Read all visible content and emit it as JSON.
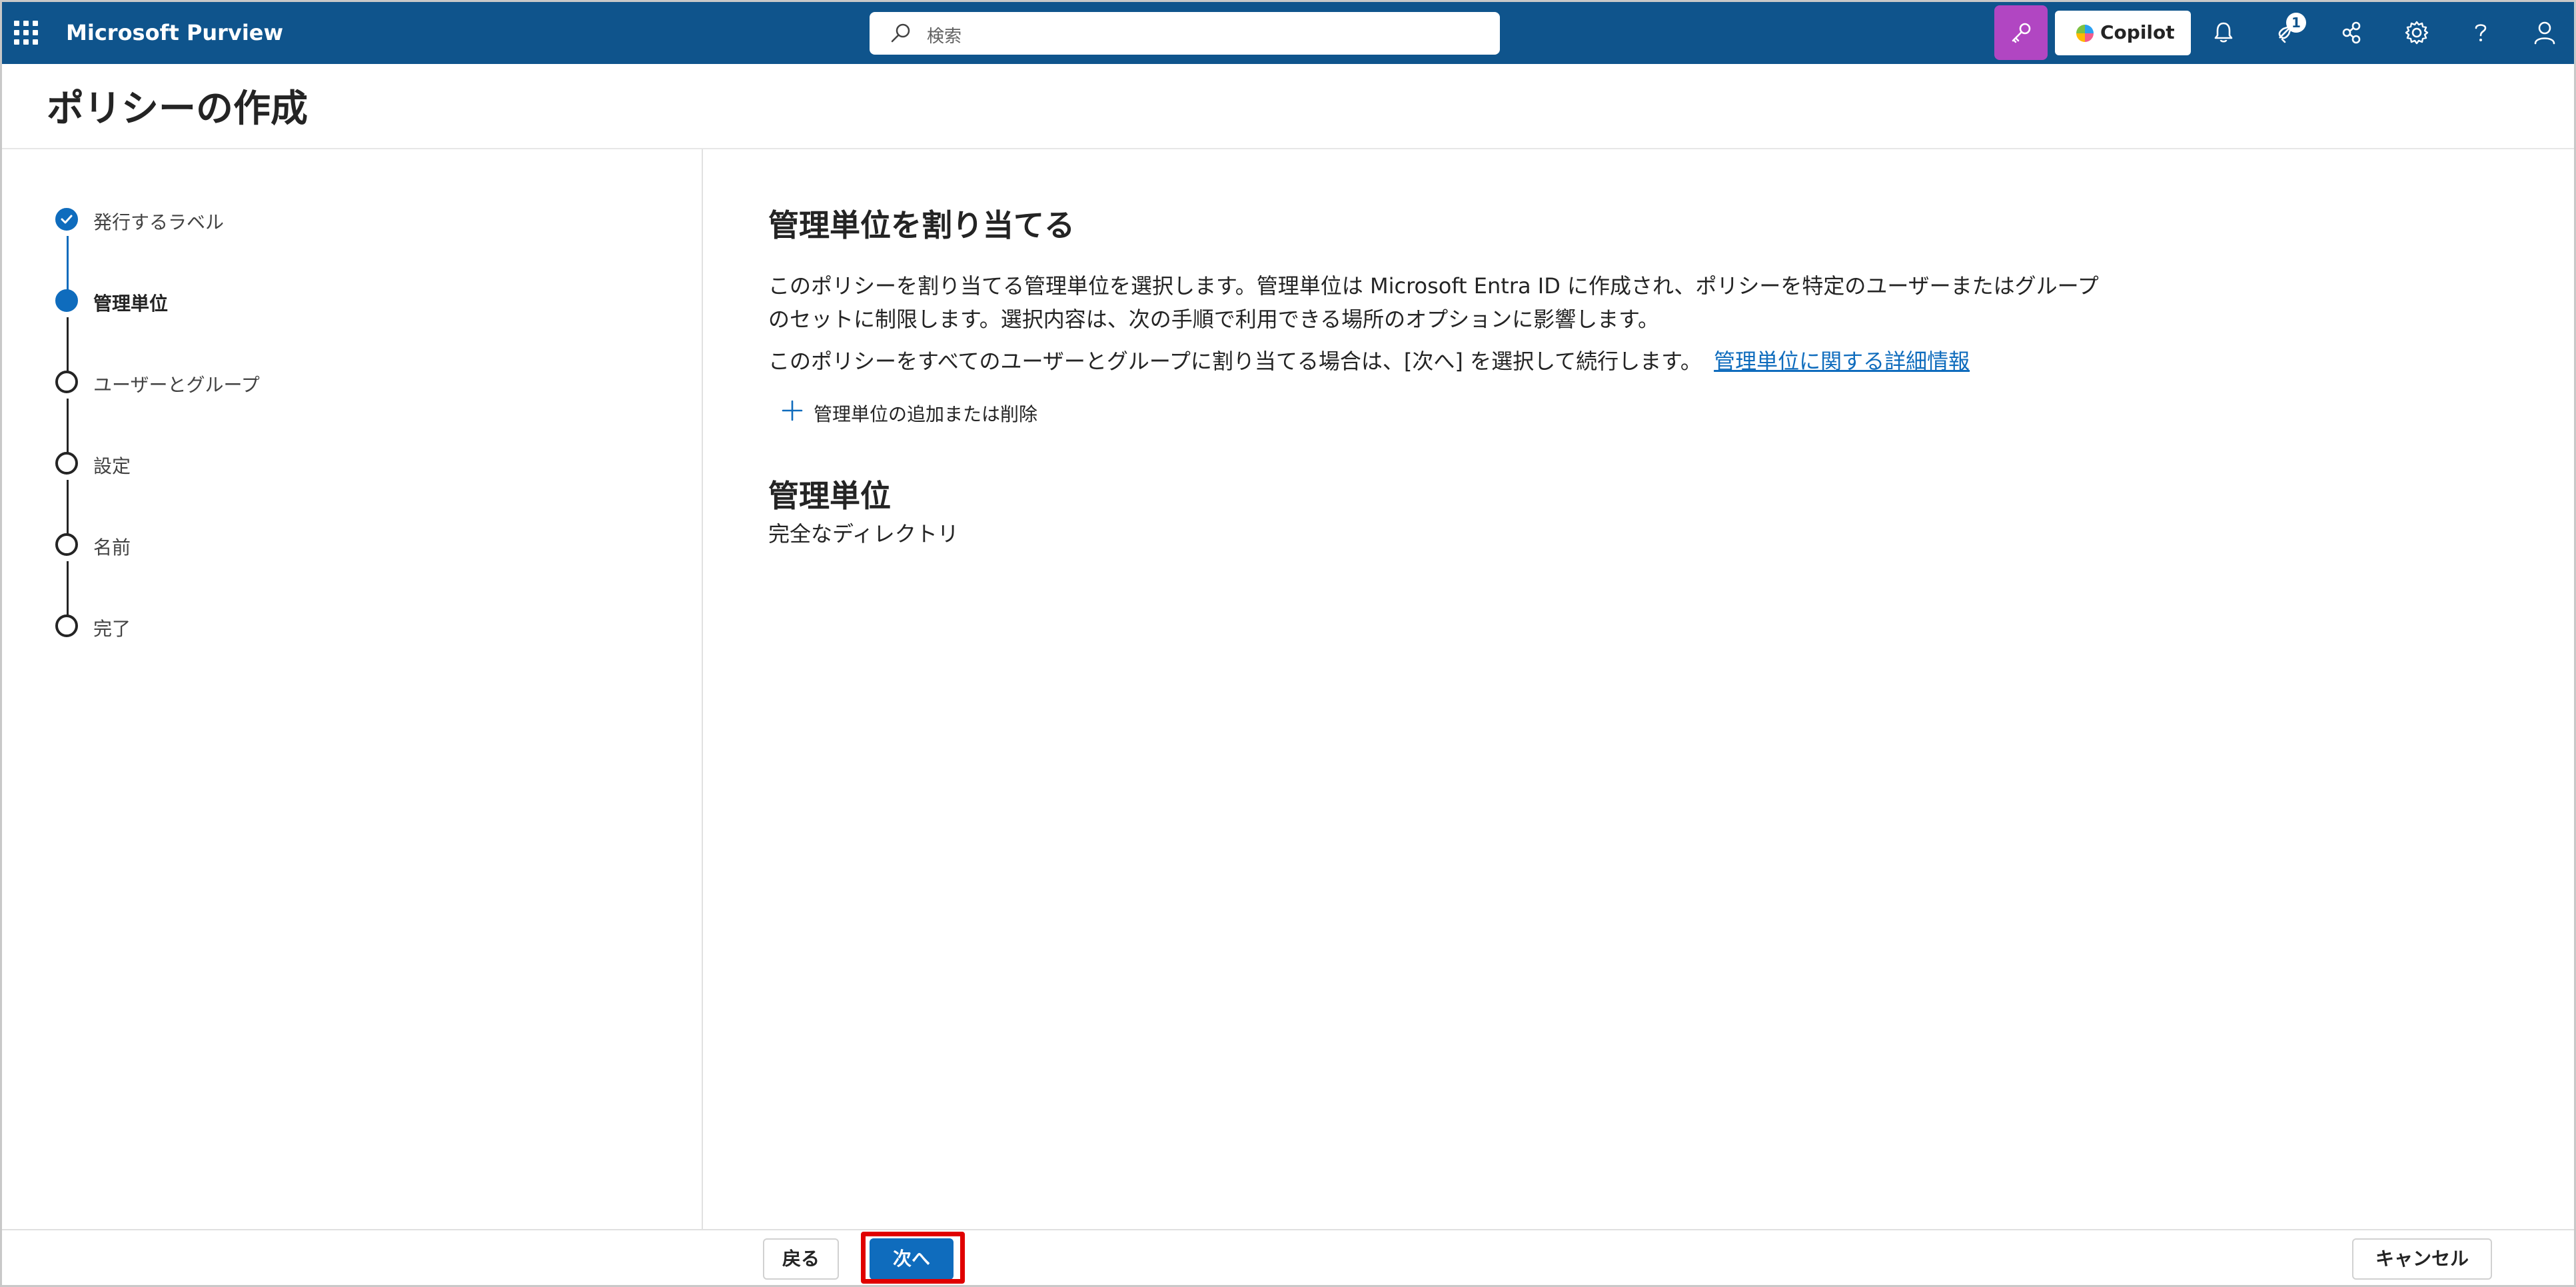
{
  "app": {
    "title": "Microsoft Purview"
  },
  "search": {
    "placeholder": "検索"
  },
  "topbar": {
    "copilot_label": "Copilot",
    "notification_count": "1",
    "icons": [
      "waffle-icon",
      "search-icon",
      "purview-agent-icon",
      "copilot-icon",
      "bell-icon",
      "megaphone-icon",
      "share-icon",
      "gear-icon",
      "help-icon",
      "person-icon"
    ]
  },
  "page": {
    "title": "ポリシーの作成"
  },
  "steps": [
    {
      "label": "発行するラベル",
      "state": "done"
    },
    {
      "label": "管理単位",
      "state": "current"
    },
    {
      "label": "ユーザーとグループ",
      "state": "pending"
    },
    {
      "label": "設定",
      "state": "pending"
    },
    {
      "label": "名前",
      "state": "pending"
    },
    {
      "label": "完了",
      "state": "pending"
    }
  ],
  "main": {
    "heading": "管理単位を割り当てる",
    "desc_line1": "このポリシーを割り当てる管理単位を選択します。管理単位は Microsoft Entra ID に作成され、ポリシーを特定のユーザーまたはグループ",
    "desc_line2": "のセットに制限します。選択内容は、次の手順で利用できる場所のオプションに影響します。",
    "desc_line3": "このポリシーをすべてのユーザーとグループに割り当てる場合は、[次へ] を選択して続行します。",
    "learn_more_link": "管理単位に関する詳細情報",
    "add_remove_label": "管理単位の追加または削除",
    "section_heading": "管理単位",
    "section_value": "完全なディレクトリ"
  },
  "footer": {
    "back_label": "戻る",
    "next_label": "次へ",
    "cancel_label": "キャンセル"
  },
  "colors": {
    "topbar": "#0f548c",
    "accent": "#0f6cbd",
    "agent_button": "#b146c2",
    "highlight": "#e00000"
  }
}
